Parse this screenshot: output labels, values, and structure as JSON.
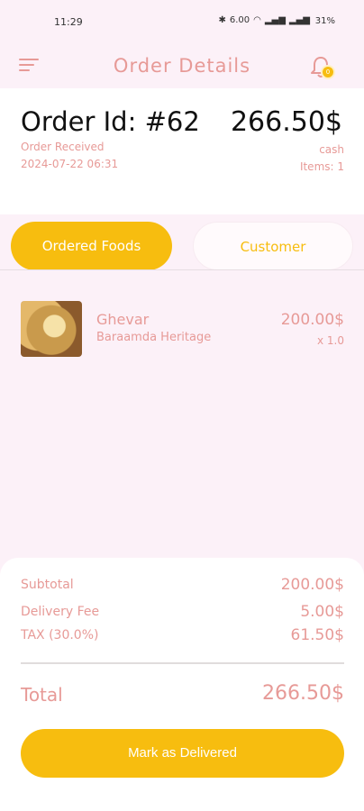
{
  "status_bar": {
    "time": "11:29",
    "battery": "31%",
    "data_speed": "6.00"
  },
  "app_bar": {
    "title": "Order Details",
    "notification_count": "0"
  },
  "order": {
    "id_label": "Order Id: #62",
    "status": "Order Received",
    "date": "2024-07-22 06:31",
    "total": "266.50$",
    "payment_method": "cash",
    "items_count": "Items: 1"
  },
  "tabs": [
    {
      "label": "Ordered Foods",
      "active": true
    },
    {
      "label": "Customer",
      "active": false
    }
  ],
  "items": [
    {
      "name": "Ghevar",
      "vendor": "Baraamda Heritage",
      "price": "200.00$",
      "quantity": "x 1.0",
      "image_icon": "ghevar-food-image"
    }
  ],
  "summary": {
    "subtotal_label": "Subtotal",
    "subtotal_value": "200.00$",
    "delivery_label": "Delivery Fee",
    "delivery_value": "5.00$",
    "tax_label": "TAX (30.0%)",
    "tax_value": "61.50$",
    "total_label": "Total",
    "total_value": "266.50$"
  },
  "actions": {
    "deliver_button": "Mark as Delivered"
  },
  "colors": {
    "accent": "#f7bd0f",
    "pink_text": "#e79a97",
    "background": "#fcf1f8"
  }
}
